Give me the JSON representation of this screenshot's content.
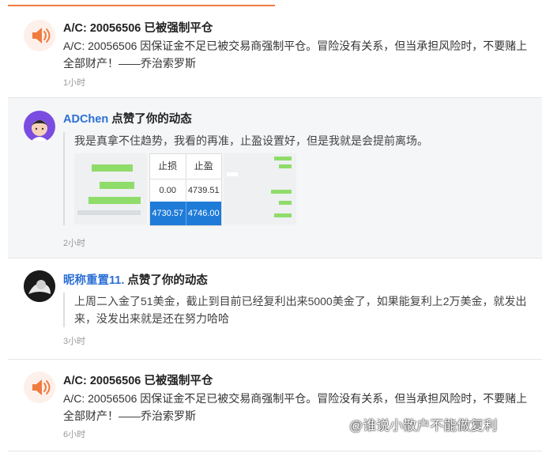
{
  "feed": {
    "items": [
      {
        "title": "A/C: 20056506 已被强制平仓",
        "body": "A/C: 20056506 因保证金不足已被交易商强制平仓。冒险没有关系，但当承担风险时，不要赌上全部财产！——乔治索罗斯",
        "time": "1小时"
      },
      {
        "user": "ADChen",
        "action": " 点赞了你的动态",
        "quote": "我是真拿不住趋势，我看的再准，止盈设置好，但是我就是会提前离场。",
        "time": "2小时",
        "thumb_table": {
          "headers": [
            "止损",
            "止盈"
          ],
          "row1": [
            "0.00",
            "4739.51"
          ],
          "row2": [
            "4730.57",
            "4746.00"
          ]
        }
      },
      {
        "user": "昵称重置11.",
        "action": " 点赞了你的动态",
        "quote": "上周二入金了51美金，截止到目前已经复利出来5000美金了，如果能复利上2万美金，就发出来，没发出来就是还在努力哈哈",
        "time": "3小时"
      },
      {
        "title": "A/C: 20056506 已被强制平仓",
        "body": "A/C: 20056506 因保证金不足已被交易商强制平仓。冒险没有关系，但当承担风险时，不要赌上全部财产！——乔治索罗斯",
        "time": "6小时"
      }
    ]
  },
  "watermark": "@谁说小散户不能做复利",
  "colors": {
    "accent": "#f07b3f",
    "link": "#2b6fd6",
    "highlight_bg": "#f5f6f8",
    "table_blue": "#1f7bd8",
    "chat_green": "#8fdc6a"
  },
  "icons": [
    "speaker-icon",
    "avatar-adchen",
    "avatar-nickname"
  ]
}
